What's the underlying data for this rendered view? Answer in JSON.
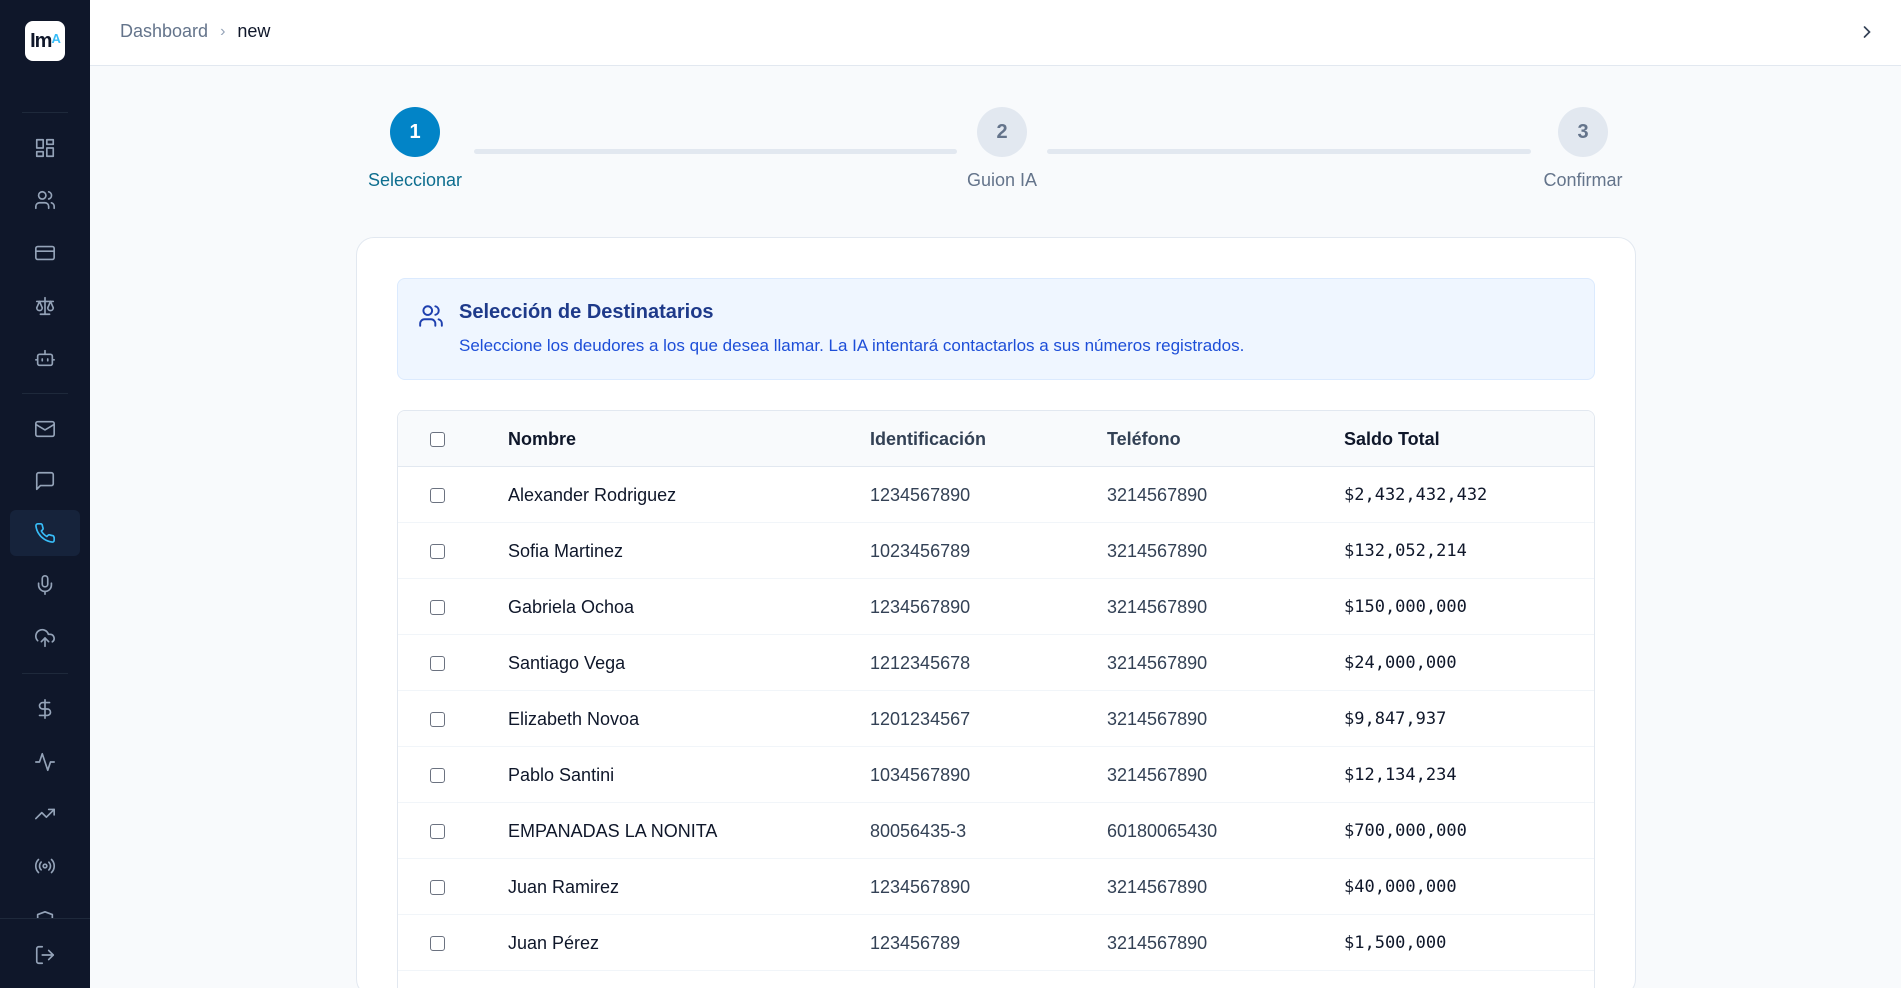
{
  "app": {
    "logo_text": "Im"
  },
  "breadcrumb": {
    "items": [
      "Dashboard",
      "new"
    ],
    "separator": "›"
  },
  "stepper": [
    {
      "number": "1",
      "label": "Seleccionar",
      "active": true
    },
    {
      "number": "2",
      "label": "Guion IA",
      "active": false
    },
    {
      "number": "3",
      "label": "Confirmar",
      "active": false
    }
  ],
  "info": {
    "title": "Selección de Destinatarios",
    "subtitle": "Seleccione los deudores a los que desea llamar. La IA intentará contactarlos a sus números registrados."
  },
  "table": {
    "headers": {
      "name": "Nombre",
      "id": "Identificación",
      "phone": "Teléfono",
      "balance": "Saldo Total"
    },
    "rows": [
      {
        "name": "Alexander Rodriguez",
        "id": "1234567890",
        "phone": "3214567890",
        "balance": "$2,432,432,432"
      },
      {
        "name": "Sofia Martinez",
        "id": "1023456789",
        "phone": "3214567890",
        "balance": "$132,052,214"
      },
      {
        "name": "Gabriela Ochoa",
        "id": "1234567890",
        "phone": "3214567890",
        "balance": "$150,000,000"
      },
      {
        "name": "Santiago Vega",
        "id": "1212345678",
        "phone": "3214567890",
        "balance": "$24,000,000"
      },
      {
        "name": "Elizabeth Novoa",
        "id": "1201234567",
        "phone": "3214567890",
        "balance": "$9,847,937"
      },
      {
        "name": "Pablo Santini",
        "id": "1034567890",
        "phone": "3214567890",
        "balance": "$12,134,234"
      },
      {
        "name": "EMPANADAS LA NONITA",
        "id": "80056435-3",
        "phone": "60180065430",
        "balance": "$700,000,000"
      },
      {
        "name": "Juan Ramirez",
        "id": "1234567890",
        "phone": "3214567890",
        "balance": "$40,000,000"
      },
      {
        "name": "Juan Pérez",
        "id": "123456789",
        "phone": "3214567890",
        "balance": "$1,500,000"
      }
    ]
  },
  "sidebar_icons": [
    "dashboard-icon",
    "users-icon",
    "credit-card-icon",
    "scale-icon",
    "bot-icon",
    "mail-icon",
    "message-icon",
    "phone-icon",
    "mic-icon",
    "upload-cloud-icon",
    "dollar-icon",
    "activity-icon",
    "trending-up-icon",
    "radio-icon",
    "shield-icon",
    "logout-icon"
  ],
  "colors": {
    "sidebar_bg": "#0f172a",
    "accent": "#0284c7",
    "active_icon": "#38bdf8",
    "info_bg": "#eff6ff"
  }
}
